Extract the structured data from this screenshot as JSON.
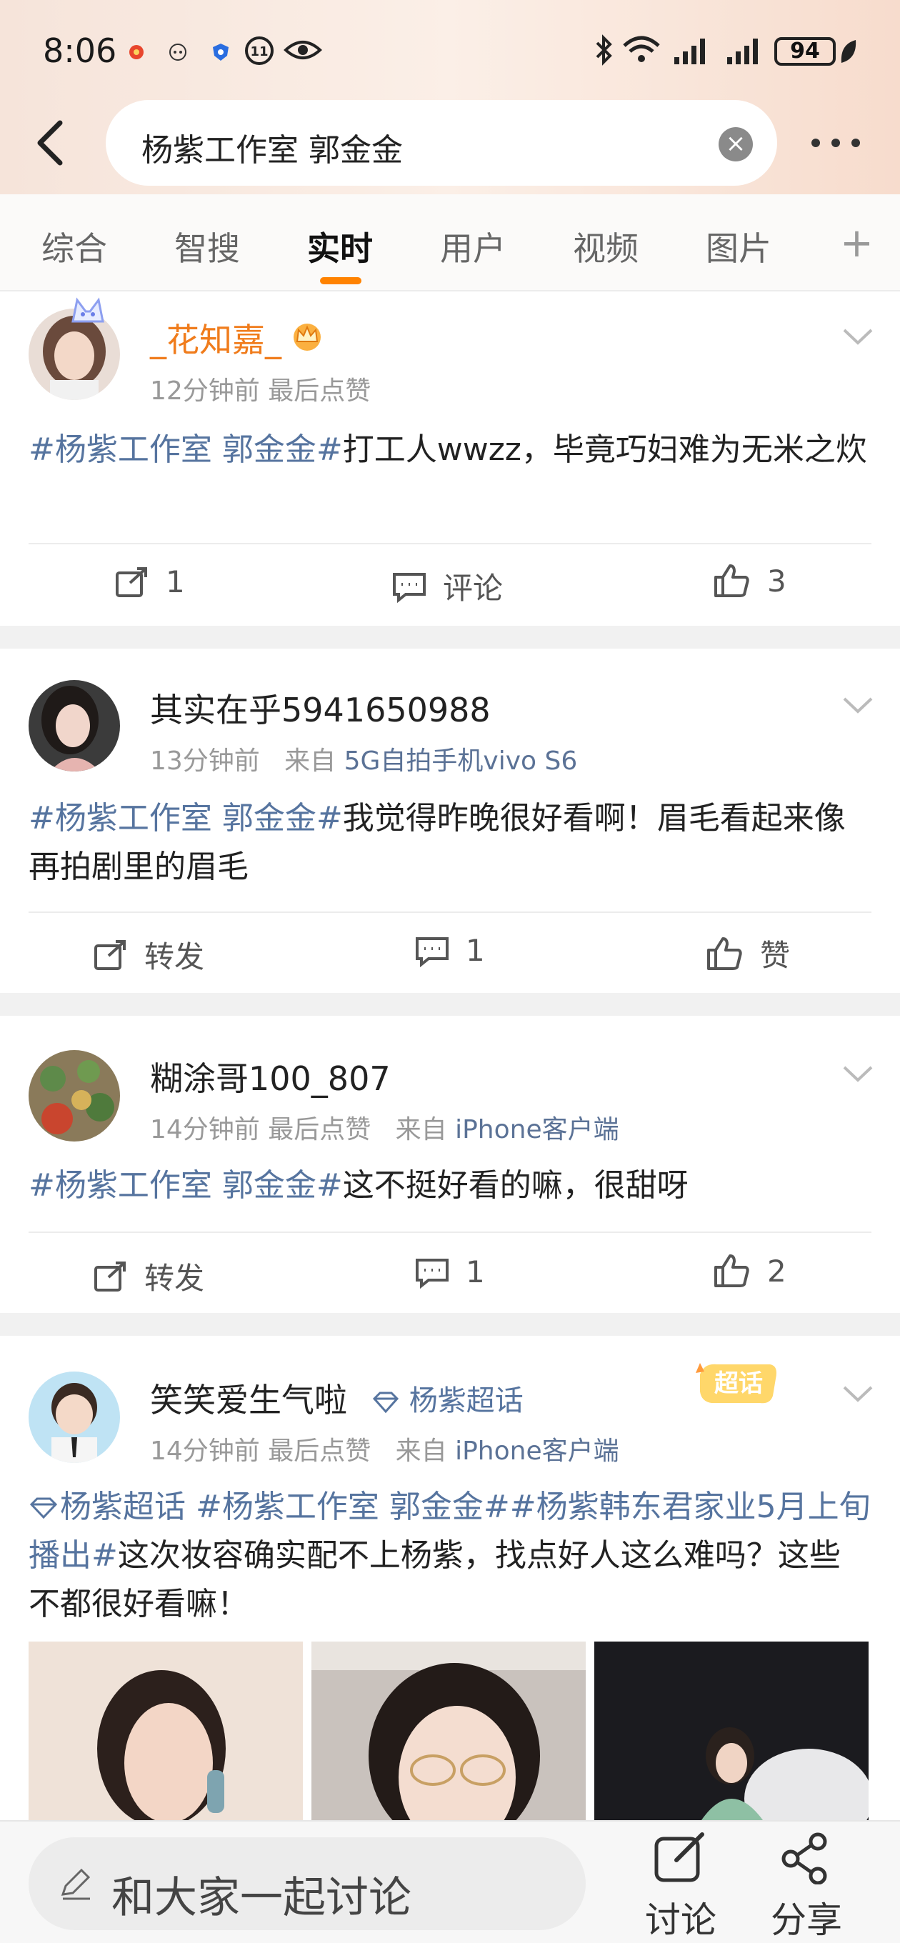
{
  "status_bar": {
    "time": "8:06",
    "battery": "94"
  },
  "search": {
    "query": "杨紫工作室 郭金金"
  },
  "tabs": [
    {
      "label": "综合"
    },
    {
      "label": "智搜"
    },
    {
      "label": "实时"
    },
    {
      "label": "用户"
    },
    {
      "label": "视频"
    },
    {
      "label": "图片"
    }
  ],
  "accent_color": "#ff8200",
  "link_color": "#56749f",
  "posts": [
    {
      "username": "_花知嘉_",
      "time": "12分钟前",
      "extra": "最后点赞",
      "tag": "#杨紫工作室 郭金金#",
      "text": "打工人wwzz，毕竟巧妇难为无米之炊",
      "repost": "1",
      "comment": "评论",
      "like": "3"
    },
    {
      "username": "其实在乎5941650988",
      "time": "13分钟前",
      "source_prefix": "来自",
      "source": "5G自拍手机vivo S6",
      "tag": "#杨紫工作室 郭金金#",
      "text": "我觉得昨晚很好看啊！眉毛看起来像再拍剧里的眉毛",
      "repost": "转发",
      "comment": "1",
      "like": "赞"
    },
    {
      "username": "糊涂哥100_807",
      "time": "14分钟前",
      "extra": "最后点赞",
      "source_prefix": "来自",
      "source": "iPhone客户端",
      "tag": "#杨紫工作室 郭金金#",
      "text": "这不挺好看的嘛，很甜呀",
      "repost": "转发",
      "comment": "1",
      "like": "2"
    },
    {
      "username": "笑笑爱生气啦",
      "super_topic": "杨紫超话",
      "badge": "超话",
      "time": "14分钟前",
      "extra": "最后点赞",
      "source_prefix": "来自",
      "source": "iPhone客户端",
      "tag1": "杨紫超话",
      "tag2": " #杨紫工作室 郭金金##杨紫韩东君家业5月上旬播出#",
      "text": "这次妆容确实配不上杨紫，找点好人这么难吗？这些不都很好看嘛！"
    }
  ],
  "bottom_bar": {
    "input_placeholder": "和大家一起讨论",
    "discuss_label": "讨论",
    "share_label": "分享"
  }
}
